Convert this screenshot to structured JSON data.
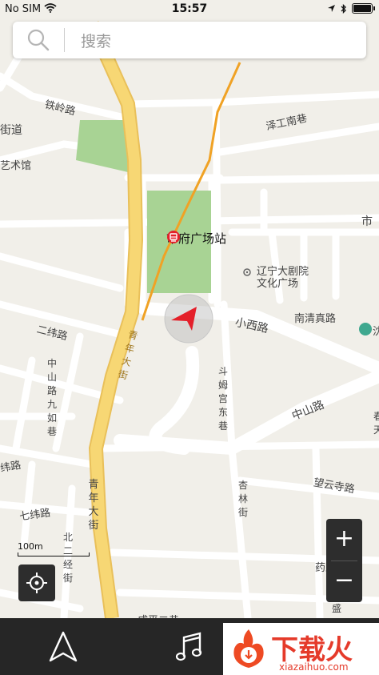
{
  "status": {
    "carrier": "No SIM",
    "time": "15:57"
  },
  "search": {
    "placeholder": "搜索"
  },
  "map": {
    "station_name": "市府广场站",
    "labels": {
      "tieling": "铁岭路",
      "jiedao": "街道",
      "yishuguan": "艺术馆",
      "zegongnanxiang": "泽工南巷",
      "shi": "市",
      "liaoning1": "辽宁大剧院",
      "liaoning2": "文化广场",
      "xiaoxi": "小西路",
      "nanqingzhen": "南清真路",
      "erwei": "二纬路",
      "zhongshan": "中山路",
      "wangyun": "望云寺路",
      "qiwei": "七纬路",
      "weilu": "纬路",
      "yaowang": "药王庙路",
      "chengping": "成平二巷",
      "chun": "春天",
      "shen": "沈"
    },
    "vlabels": {
      "zhongshanjiuru": "中山路九如巷",
      "doumu": "斗姆宫东巷",
      "qingnian": "青年大街",
      "xinglin": "杏林街",
      "beierjing": "北二经街",
      "qingnian_top": "青年大街",
      "sheng": "盛"
    }
  },
  "zoom": {
    "in": "+",
    "out": "−"
  },
  "scale": {
    "label": "100m"
  },
  "tabbar": {
    "nav": "navigation-arrow-icon",
    "music": "music-note-icon"
  },
  "brand": {
    "name": "下载火",
    "url": "xiazaihuo.com"
  }
}
